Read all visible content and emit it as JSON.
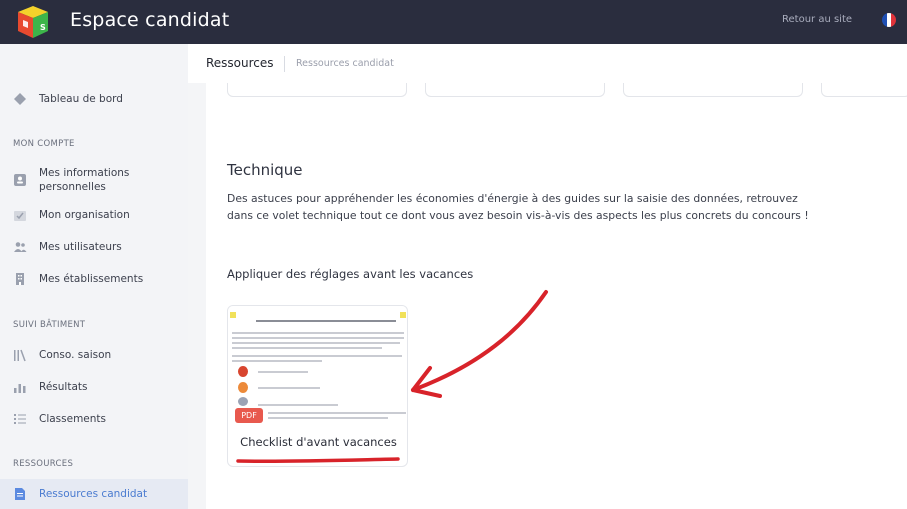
{
  "header": {
    "app_title": "Espace candidat",
    "back_link": "Retour au site",
    "logo_text": "CUBE S",
    "flag_colors": [
      "#1f4fb3",
      "#ffffff",
      "#e0333a"
    ]
  },
  "sidebar": {
    "dashboard": {
      "label": "Tableau de bord",
      "icon": "diamond-icon"
    },
    "sections": [
      {
        "heading": "MON COMPTE",
        "items": [
          {
            "label": "Mes informations personnelles",
            "icon": "user-card-icon"
          },
          {
            "label": "Mon organisation",
            "icon": "organisation-icon"
          },
          {
            "label": "Mes utilisateurs",
            "icon": "users-icon"
          },
          {
            "label": "Mes établissements",
            "icon": "building-icon"
          }
        ]
      },
      {
        "heading": "SUIVI BÂTIMENT",
        "items": [
          {
            "label": "Conso. saison",
            "icon": "bars-icon"
          },
          {
            "label": "Résultats",
            "icon": "chart-icon"
          },
          {
            "label": "Classements",
            "icon": "list-icon"
          }
        ]
      },
      {
        "heading": "RESSOURCES",
        "items": [
          {
            "label": "Ressources candidat",
            "icon": "document-icon",
            "active": true
          }
        ]
      }
    ]
  },
  "tabs": {
    "main": "Ressources",
    "sub": "Ressources candidat"
  },
  "content": {
    "section_title": "Technique",
    "section_description": "Des astuces pour appréhender les économies d'énergie à des guides sur la saisie des données, retrouvez dans ce volet technique tout ce dont vous avez besoin vis-à-vis des aspects les plus concrets du concours !",
    "subsection_title": "Appliquer des réglages avant les vacances",
    "document": {
      "title": "Checklist d'avant vacances",
      "badge": "PDF"
    }
  },
  "colors": {
    "topbar": "#2a2d3e",
    "accent": "#4a7bd0",
    "annotation": "#d8232a",
    "pdf_badge": "#e8594e"
  }
}
